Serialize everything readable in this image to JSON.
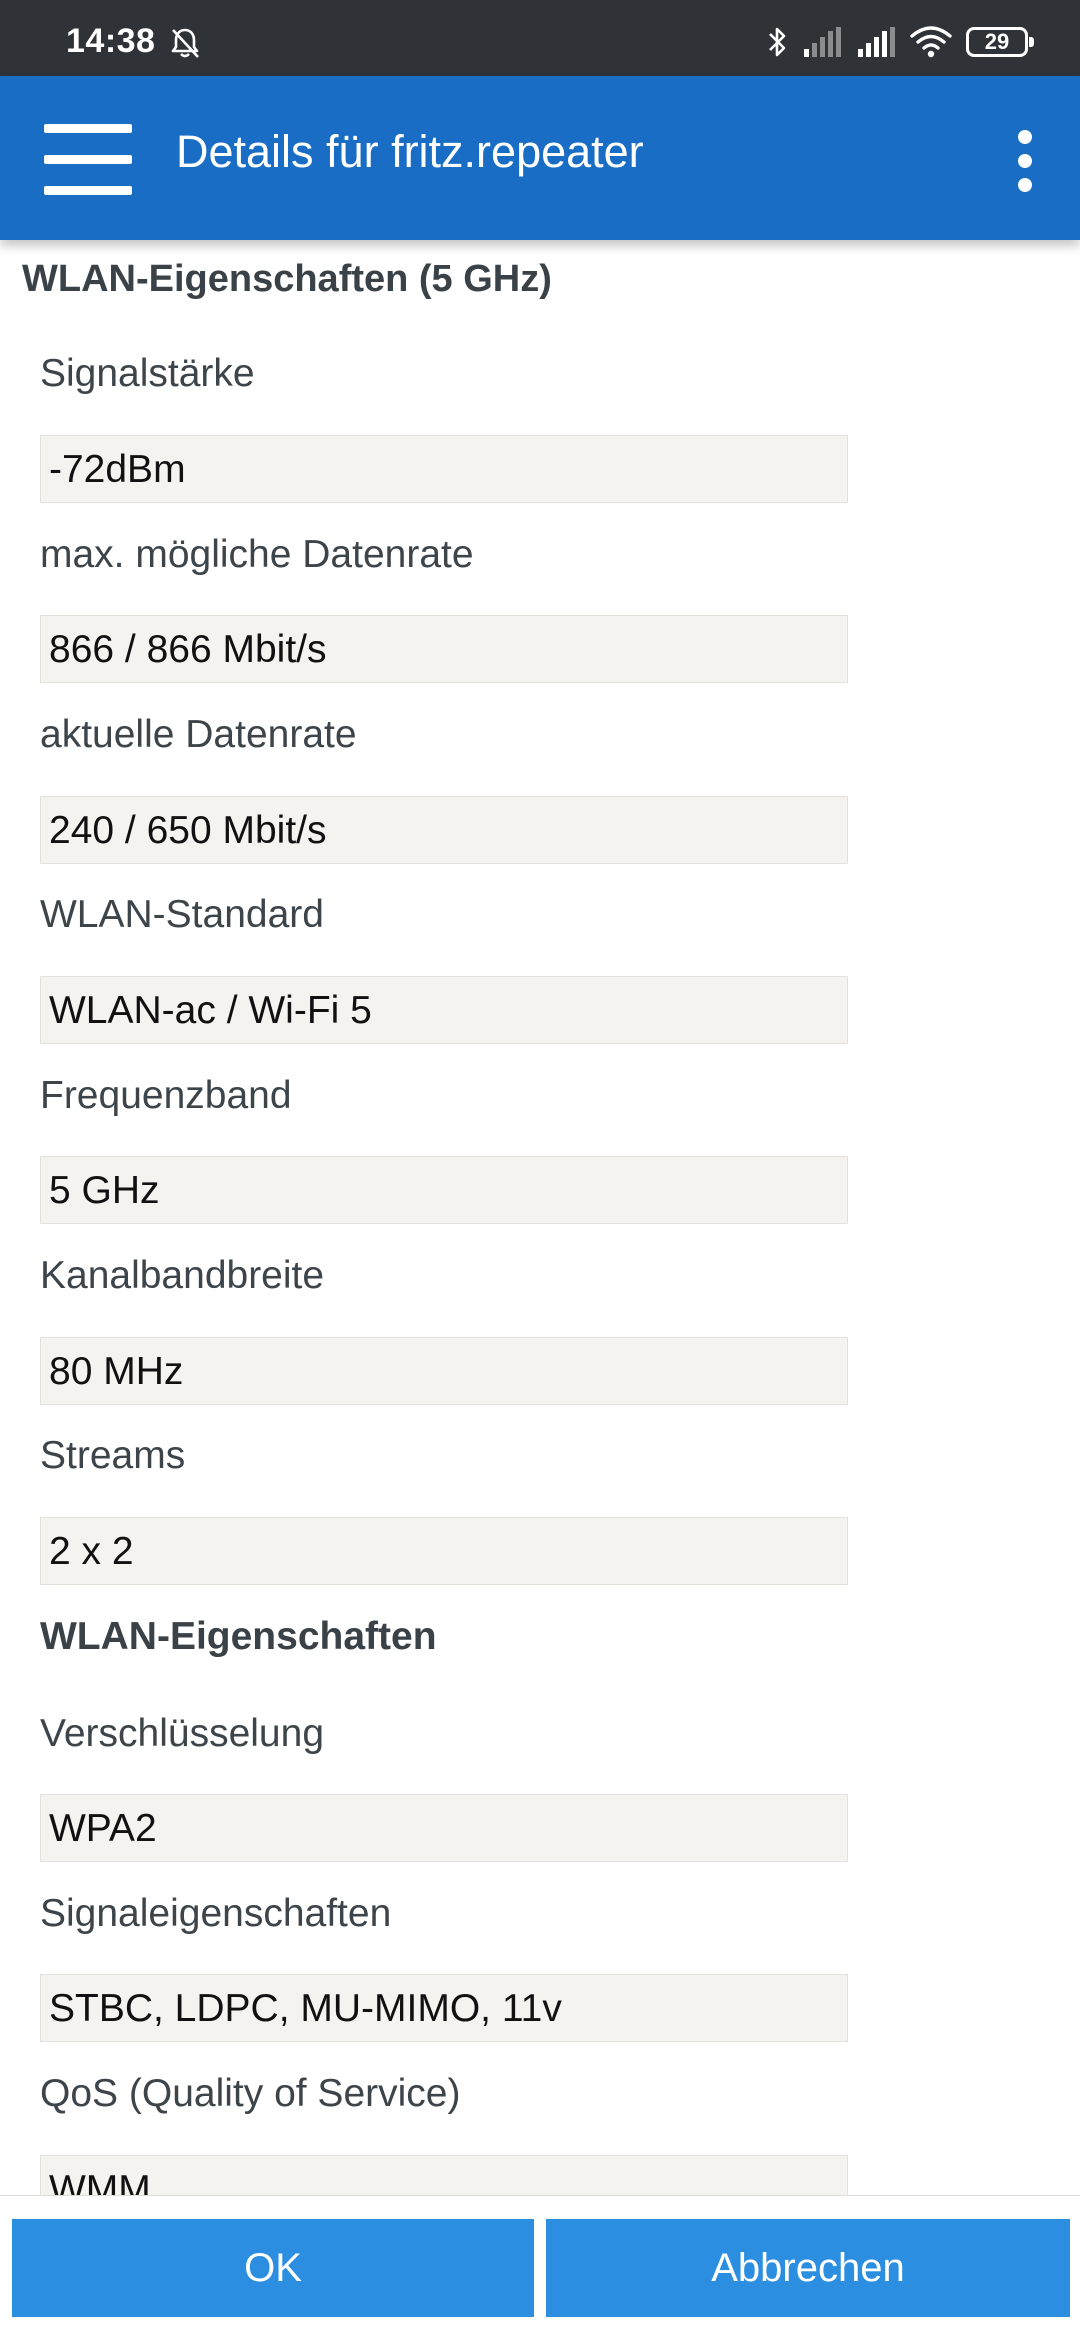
{
  "status_bar": {
    "time": "14:38",
    "battery": "29",
    "icons": [
      "bell-off-icon",
      "bluetooth-icon",
      "signal-icon",
      "signal-icon",
      "wifi-icon",
      "battery-icon"
    ]
  },
  "app_bar": {
    "title": "Details für fritz.repeater",
    "menu_icon": "hamburger-menu-icon",
    "overflow_icon": "more-vert-icon"
  },
  "section": {
    "title": "WLAN-Eigenschaften (5 GHz)",
    "fields": [
      {
        "label": "Signalstärke",
        "value": "-72dBm"
      },
      {
        "label": "max. mögliche Datenrate",
        "value": "866 / 866 Mbit/s"
      },
      {
        "label": "aktuelle Datenrate",
        "value": "240 / 650 Mbit/s"
      },
      {
        "label": "WLAN-Standard",
        "value": "WLAN-ac / Wi-Fi 5"
      },
      {
        "label": "Frequenzband",
        "value": "5 GHz"
      },
      {
        "label": "Kanalbandbreite",
        "value": "80 MHz"
      },
      {
        "label": "Streams",
        "value": "2 x 2"
      }
    ]
  },
  "subsection": {
    "title": "WLAN-Eigenschaften",
    "fields": [
      {
        "label": "Verschlüsselung",
        "value": "WPA2"
      },
      {
        "label": "Signaleigenschaften",
        "value": "STBC, LDPC, MU-MIMO, 11v"
      },
      {
        "label": "QoS (Quality of Service)",
        "value": "WMM"
      }
    ]
  },
  "buttons": {
    "ok": "OK",
    "cancel": "Abbrechen"
  },
  "colors": {
    "app_bar": "#1a6dc4",
    "button": "#2b8ee0",
    "status_bar": "#2f3237",
    "field_bg": "#f4f3f0"
  }
}
